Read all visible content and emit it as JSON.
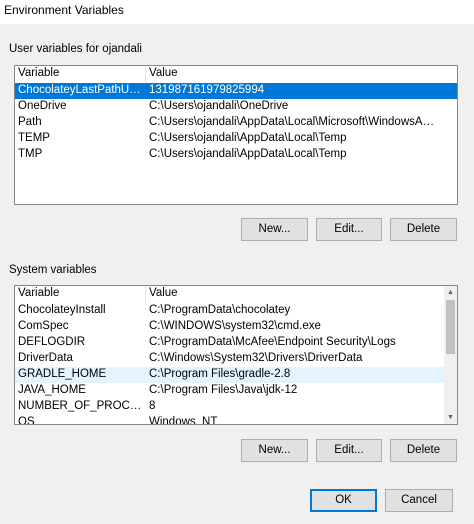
{
  "window": {
    "title": "Environment Variables"
  },
  "user_section": {
    "label": "User variables for ojandali",
    "columns": [
      "Variable",
      "Value"
    ],
    "rows": [
      {
        "variable": "ChocolateyLastPathUpdate",
        "value": "131987161979825994"
      },
      {
        "variable": "OneDrive",
        "value": "C:\\Users\\ojandali\\OneDrive"
      },
      {
        "variable": "Path",
        "value": "C:\\Users\\ojandali\\AppData\\Local\\Microsoft\\WindowsApps;C:\\Users..."
      },
      {
        "variable": "TEMP",
        "value": "C:\\Users\\ojandali\\AppData\\Local\\Temp"
      },
      {
        "variable": "TMP",
        "value": "C:\\Users\\ojandali\\AppData\\Local\\Temp"
      }
    ],
    "buttons": {
      "new": "New...",
      "edit": "Edit...",
      "delete": "Delete"
    }
  },
  "system_section": {
    "label": "System variables",
    "columns": [
      "Variable",
      "Value"
    ],
    "rows": [
      {
        "variable": "ChocolateyInstall",
        "value": "C:\\ProgramData\\chocolatey"
      },
      {
        "variable": "ComSpec",
        "value": "C:\\WINDOWS\\system32\\cmd.exe"
      },
      {
        "variable": "DEFLOGDIR",
        "value": "C:\\ProgramData\\McAfee\\Endpoint Security\\Logs"
      },
      {
        "variable": "DriverData",
        "value": "C:\\Windows\\System32\\Drivers\\DriverData"
      },
      {
        "variable": "GRADLE_HOME",
        "value": "C:\\Program Files\\gradle-2.8"
      },
      {
        "variable": "JAVA_HOME",
        "value": "C:\\Program Files\\Java\\jdk-12"
      },
      {
        "variable": "NUMBER_OF_PROCESSORS",
        "value": "8"
      },
      {
        "variable": "OS",
        "value": "Windows_NT"
      }
    ],
    "buttons": {
      "new": "New...",
      "edit": "Edit...",
      "delete": "Delete"
    }
  },
  "footer": {
    "ok": "OK",
    "cancel": "Cancel"
  },
  "colors": {
    "selection": "#0078d7",
    "hover": "#e5f3ff",
    "default_button_border": "#0078d7"
  }
}
